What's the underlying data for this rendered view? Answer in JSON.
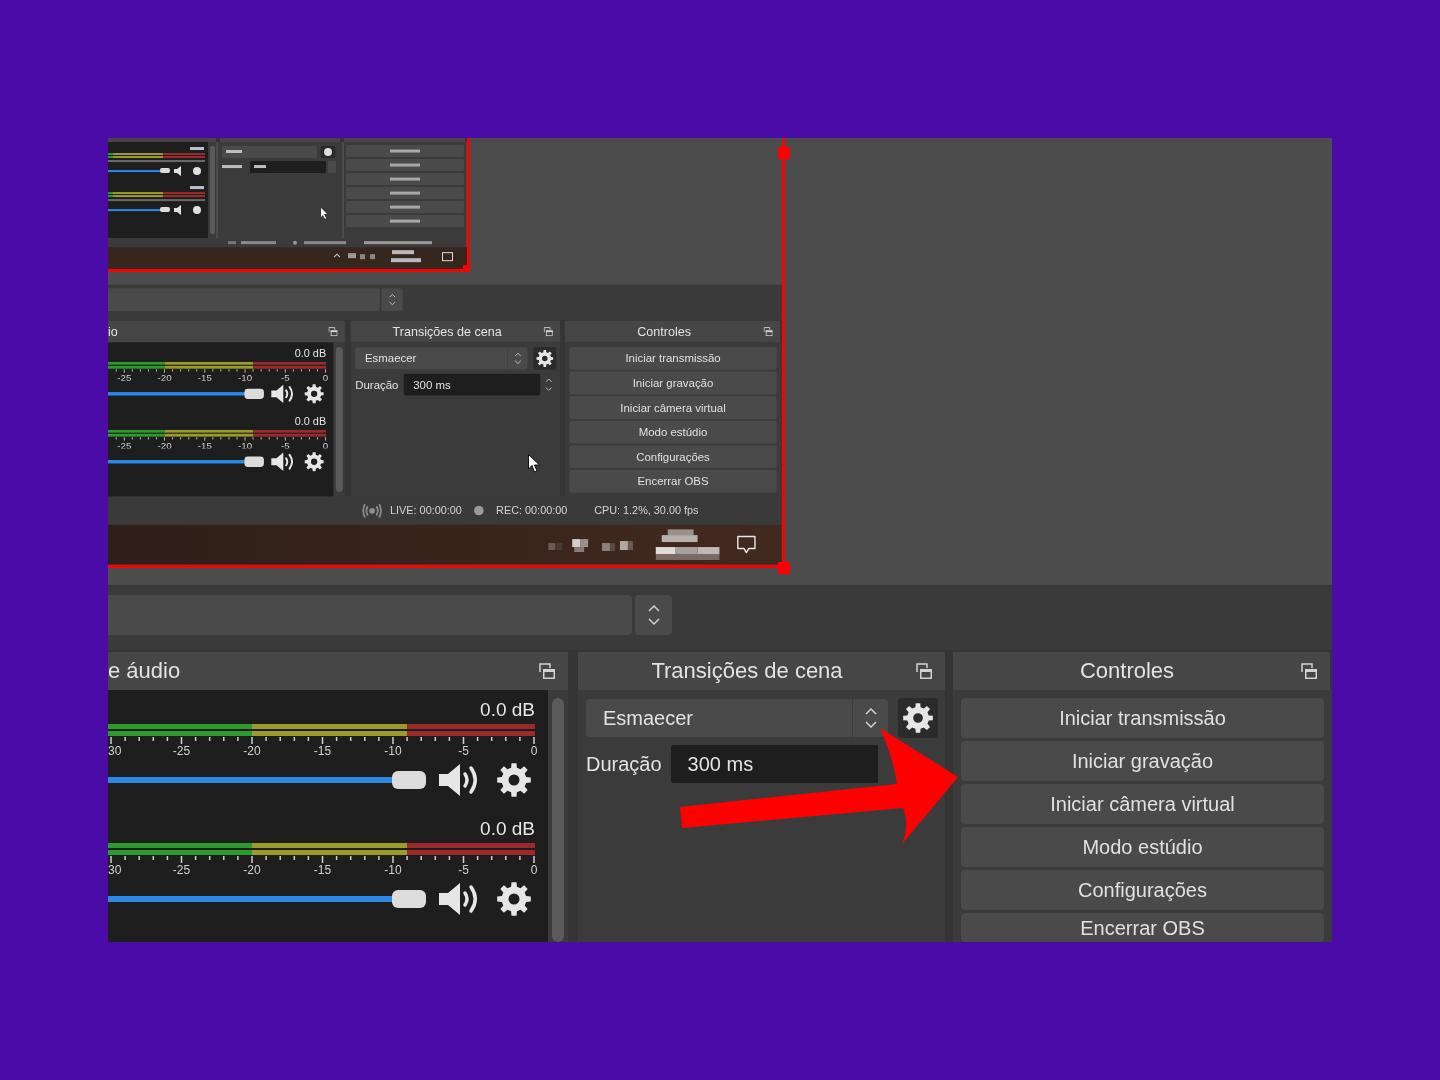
{
  "preview": {
    "source": {
      "selected": true,
      "mixer": {
        "title": "io",
        "channels": [
          {
            "reading": "0.0 dB",
            "ticks": [
              "-25",
              "-20",
              "-15",
              "-10",
              "-5",
              "0"
            ],
            "level": 1
          },
          {
            "reading": "0.0 dB",
            "ticks": [
              "-25",
              "-20",
              "-15",
              "-10",
              "-5",
              "0"
            ],
            "level": 1
          }
        ]
      },
      "transitions": {
        "title": "Transições de cena",
        "transition": "Esmaecer",
        "duration_label": "Duração",
        "duration": "300 ms"
      },
      "controls": {
        "title": "Controles",
        "buttons": [
          "Iniciar transmissão",
          "Iniciar gravação",
          "Iniciar câmera virtual",
          "Modo estúdio",
          "Configurações",
          "Encerrar OBS"
        ]
      },
      "status_bar": {
        "live": "LIVE: 00:00:00",
        "rec": "REC: 00:00:00",
        "cpu": "CPU: 1.2%, 30.00 fps"
      }
    }
  },
  "mixer": {
    "title": "e áudio",
    "channels": [
      {
        "reading": "0.0 dB",
        "ticks": [
          "30",
          "-25",
          "-20",
          "-15",
          "-10",
          "-5",
          "0"
        ],
        "level": 1
      },
      {
        "reading": "0.0 dB",
        "ticks": [
          "30",
          "-25",
          "-20",
          "-15",
          "-10",
          "-5",
          "0"
        ],
        "level": 1
      }
    ]
  },
  "transitions": {
    "title": "Transições de cena",
    "transition": "Esmaecer",
    "duration_label": "Duração",
    "duration": "300 ms"
  },
  "controls": {
    "title": "Controles",
    "buttons": [
      "Iniciar transmissão",
      "Iniciar gravação",
      "Iniciar câmera virtual",
      "Modo estúdio",
      "Configurações",
      "Encerrar OBS"
    ]
  }
}
